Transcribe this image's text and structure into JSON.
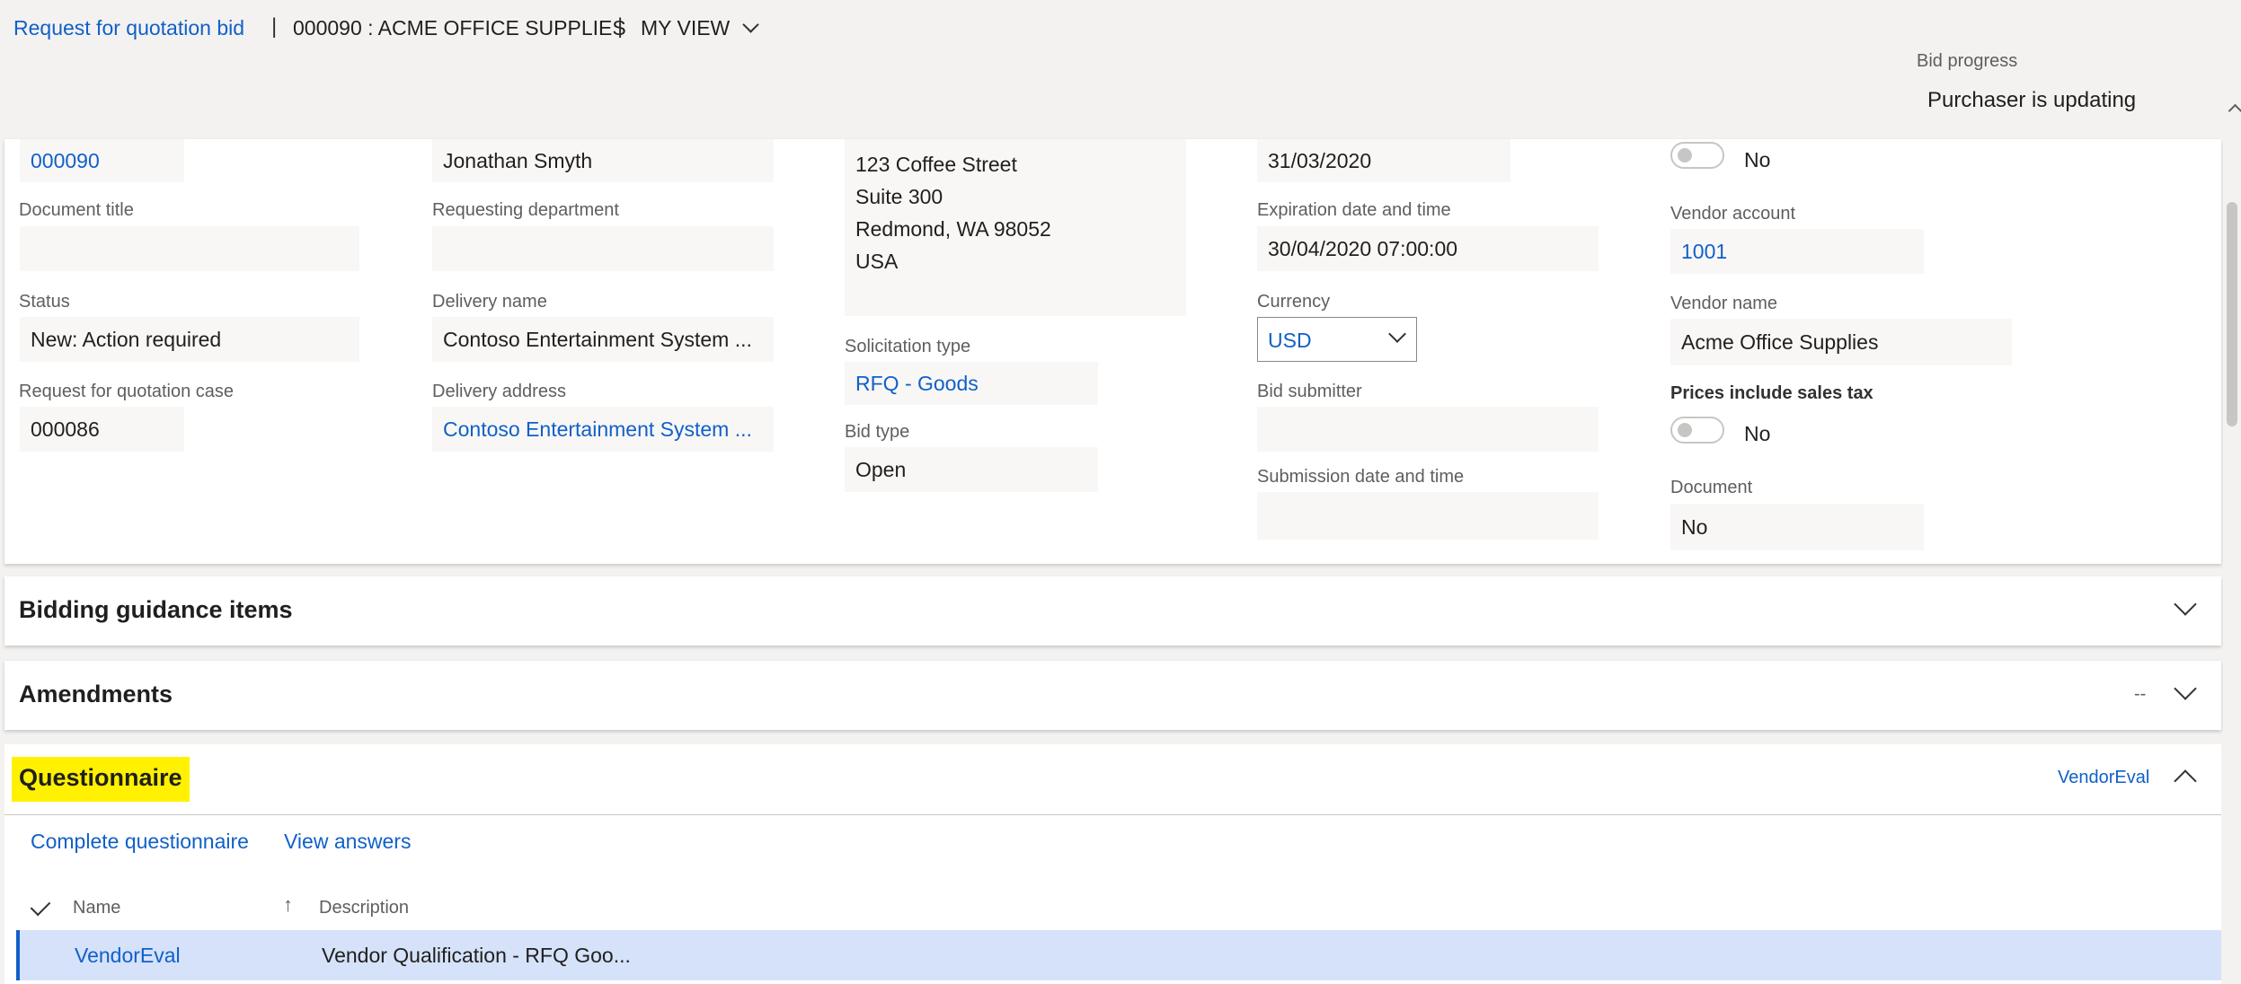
{
  "header": {
    "breadcrumb_page": "Request for quotation bid",
    "separator": "|",
    "breadcrumb_record": "000090 : ACME OFFICE SUPPLIES",
    "view_label": "MY VIEW",
    "bid_progress_label": "Bid progress",
    "bid_progress_value": "Purchaser is updating"
  },
  "fields": {
    "rfq_number": "000090",
    "document_title_label": "Document title",
    "document_title": "",
    "status_label": "Status",
    "status": "New: Action required",
    "rfq_case_label": "Request for quotation case",
    "rfq_case": "000086",
    "requester": "Jonathan Smyth",
    "requesting_department_label": "Requesting department",
    "requesting_department": "",
    "delivery_name_label": "Delivery name",
    "delivery_name": "Contoso Entertainment System ...",
    "delivery_address_label": "Delivery address",
    "delivery_address": "Contoso Entertainment System ...",
    "address_line1": "123 Coffee Street",
    "address_line2": "Suite 300",
    "address_line3": "Redmond, WA 98052",
    "address_line4": "USA",
    "solicitation_type_label": "Solicitation type",
    "solicitation_type": "RFQ - Goods",
    "bid_type_label": "Bid type",
    "bid_type": "Open",
    "date_top": "31/03/2020",
    "expiration_label": "Expiration date and time",
    "expiration": "30/04/2020 07:00:00",
    "currency_label": "Currency",
    "currency": "USD",
    "bid_submitter_label": "Bid submitter",
    "bid_submitter": "",
    "submission_label": "Submission date and time",
    "submission": "",
    "toggle_top_value": "No",
    "vendor_account_label": "Vendor account",
    "vendor_account": "1001",
    "vendor_name_label": "Vendor name",
    "vendor_name": "Acme Office Supplies",
    "prices_tax_label": "Prices include sales tax",
    "prices_tax_value": "No",
    "document_label": "Document",
    "document": "No"
  },
  "sections": {
    "bidding_guidance": "Bidding guidance items",
    "amendments": "Amendments",
    "amendments_summary": "--",
    "questionnaire": "Questionnaire",
    "questionnaire_summary": "VendorEval"
  },
  "questionnaire": {
    "complete_button": "Complete questionnaire",
    "view_answers_button": "View answers",
    "columns": {
      "name": "Name",
      "description": "Description"
    },
    "rows": [
      {
        "name": "VendorEval",
        "description": "Vendor Qualification - RFQ Goo..."
      }
    ]
  },
  "colors": {
    "link": "#1160c8",
    "highlight": "#fff100",
    "selected_row": "#d5e2f9"
  }
}
